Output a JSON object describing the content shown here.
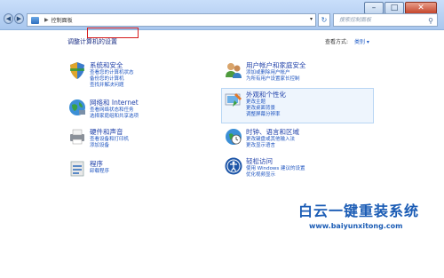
{
  "window": {
    "controls": {
      "minimize": "–",
      "maximize": "□",
      "close": "✕"
    }
  },
  "address_bar": {
    "back_icon": "◀",
    "forward_icon": "▶",
    "separator": "▶",
    "path": "控制面板",
    "dropdown_icon": "▾",
    "refresh_icon": "↻"
  },
  "search": {
    "placeholder": "搜索控制面板",
    "icon": "⚲"
  },
  "main": {
    "heading": "调整计算机的设置",
    "view_by_label": "查看方式:",
    "view_by_value": "类别 ▾"
  },
  "categories": {
    "system": {
      "title": "系统和安全",
      "links": [
        "查看您的计算机状态",
        "备份您的计算机",
        "查找并解决问题"
      ]
    },
    "network": {
      "title": "网络和 Internet",
      "links": [
        "查看网络状态和任务",
        "选择家庭组和共享选项"
      ]
    },
    "hardware": {
      "title": "硬件和声音",
      "links": [
        "查看设备和打印机",
        "添加设备"
      ]
    },
    "programs": {
      "title": "程序",
      "links": [
        "卸载程序"
      ]
    },
    "users": {
      "title": "用户帐户和家庭安全",
      "links": [
        "添加或删除用户帐户",
        "为所有用户设置家长控制"
      ]
    },
    "appearance": {
      "title": "外观和个性化",
      "links": [
        "更改主题",
        "更改桌面背景",
        "调整屏幕分辨率"
      ]
    },
    "clock": {
      "title": "时钟、语言和区域",
      "links": [
        "更改键盘或其他输入法",
        "更改显示语言"
      ]
    },
    "ease": {
      "title": "轻松访问",
      "links": [
        "使用 Windows 建议的设置",
        "优化视频显示"
      ]
    }
  },
  "watermark": {
    "title": "白云一键重装系统",
    "url": "www.baiyunxitong.com"
  }
}
